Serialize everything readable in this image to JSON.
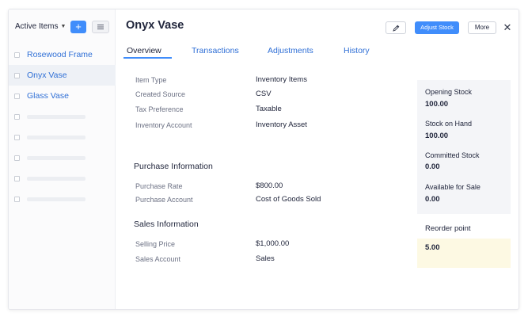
{
  "sidebar": {
    "filter_label": "Active Items",
    "add_label": "+",
    "items": [
      {
        "label": "Rosewood Frame",
        "active": false
      },
      {
        "label": "Onyx Vase",
        "active": true
      },
      {
        "label": "Glass Vase",
        "active": false
      }
    ]
  },
  "header": {
    "title": "Onyx Vase",
    "adjust_stock_label": "Adjust Stock",
    "more_label": "More",
    "close_label": "✕"
  },
  "tabs": [
    {
      "label": "Overview",
      "active": true
    },
    {
      "label": "Transactions",
      "active": false
    },
    {
      "label": "Adjustments",
      "active": false
    },
    {
      "label": "History",
      "active": false
    }
  ],
  "details": {
    "item_type_label": "Item Type",
    "item_type_value": "Inventory Items",
    "created_source_label": "Created Source",
    "created_source_value": "CSV",
    "tax_pref_label": "Tax Preference",
    "tax_pref_value": "Taxable",
    "inv_account_label": "Inventory Account",
    "inv_account_value": "Inventory Asset"
  },
  "purchase": {
    "title": "Purchase Information",
    "rate_label": "Purchase Rate",
    "rate_value": "$800.00",
    "account_label": "Purchase Account",
    "account_value": "Cost of Goods Sold"
  },
  "sales": {
    "title": "Sales Information",
    "price_label": "Selling Price",
    "price_value": "$1,000.00",
    "account_label": "Sales Account",
    "account_value": "Sales"
  },
  "stock": {
    "opening_label": "Opening Stock",
    "opening_value": "100.00",
    "on_hand_label": "Stock on Hand",
    "on_hand_value": "100.00",
    "committed_label": "Committed Stock",
    "committed_value": "0.00",
    "available_label": "Available for Sale",
    "available_value": "0.00",
    "reorder_label": "Reorder point",
    "reorder_value": "5.00"
  },
  "colors": {
    "accent": "#408dfb",
    "link": "#2f6fd6",
    "reorder_bg": "#fdf9e3"
  }
}
